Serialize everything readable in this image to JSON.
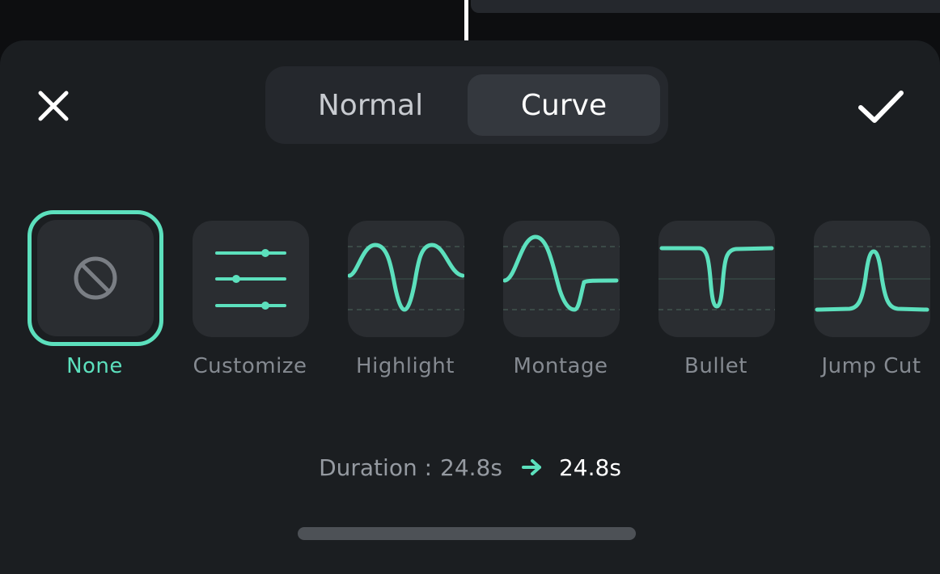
{
  "header": {
    "close_icon": "close-icon",
    "confirm_icon": "checkmark-icon"
  },
  "mode_tabs": [
    {
      "label": "Normal",
      "selected": false
    },
    {
      "label": "Curve",
      "selected": true
    }
  ],
  "presets": [
    {
      "label": "None",
      "icon": "no-entry-icon",
      "selected": true
    },
    {
      "label": "Customize",
      "icon": "sliders-icon",
      "selected": false
    },
    {
      "label": "Highlight",
      "icon": "highlight-curve-icon",
      "selected": false
    },
    {
      "label": "Montage",
      "icon": "montage-curve-icon",
      "selected": false
    },
    {
      "label": "Bullet",
      "icon": "bullet-curve-icon",
      "selected": false
    },
    {
      "label": "Jump Cut",
      "icon": "jump-cut-curve-icon",
      "selected": false
    }
  ],
  "duration": {
    "label": "Duration : ",
    "from": "24.8s",
    "to": "24.8s",
    "arrow_icon": "arrow-right-icon"
  },
  "colors": {
    "accent": "#5ce0bd",
    "sheet_background": "#1b1e21",
    "tile_background": "#2a2d31",
    "selected_tab_background": "#34383e"
  }
}
